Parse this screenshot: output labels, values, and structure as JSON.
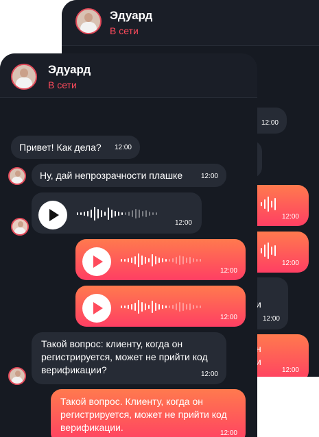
{
  "contact": {
    "name": "Эдуард",
    "status": "В сети"
  },
  "messages": {
    "greeting": {
      "text": "Привет! Как дела?",
      "time": "12:00"
    },
    "opacity": {
      "text": "Ну, дай непрозрачности плашке",
      "time": "12:00"
    },
    "voice_in": {
      "time": "12:00"
    },
    "voice_out_1": {
      "time": "12:00"
    },
    "voice_out_2": {
      "time": "12:00"
    },
    "question_in": {
      "text": "Такой вопрос: клиенту, когда он регистрируется, может не прийти код верификации?",
      "time": "12:00"
    },
    "question_out": {
      "text": "Такой вопрос. Клиенту, когда он регистрируется, может не прийти код верификации.",
      "time": "12:00"
    }
  },
  "back_card": {
    "times": [
      "12:00",
      "12:00",
      "12:00",
      "12:00",
      "12:00"
    ],
    "partial_text": [
      "и",
      "н",
      "и"
    ]
  },
  "colors": {
    "accent": "#ff4b5c",
    "gradient_top": "#ff7a4e",
    "gradient_bottom": "#ff3f63",
    "background": "#161a22",
    "bubble_in": "#262b35"
  },
  "icons": {
    "play": "play-icon",
    "waveform": "waveform-icon"
  }
}
